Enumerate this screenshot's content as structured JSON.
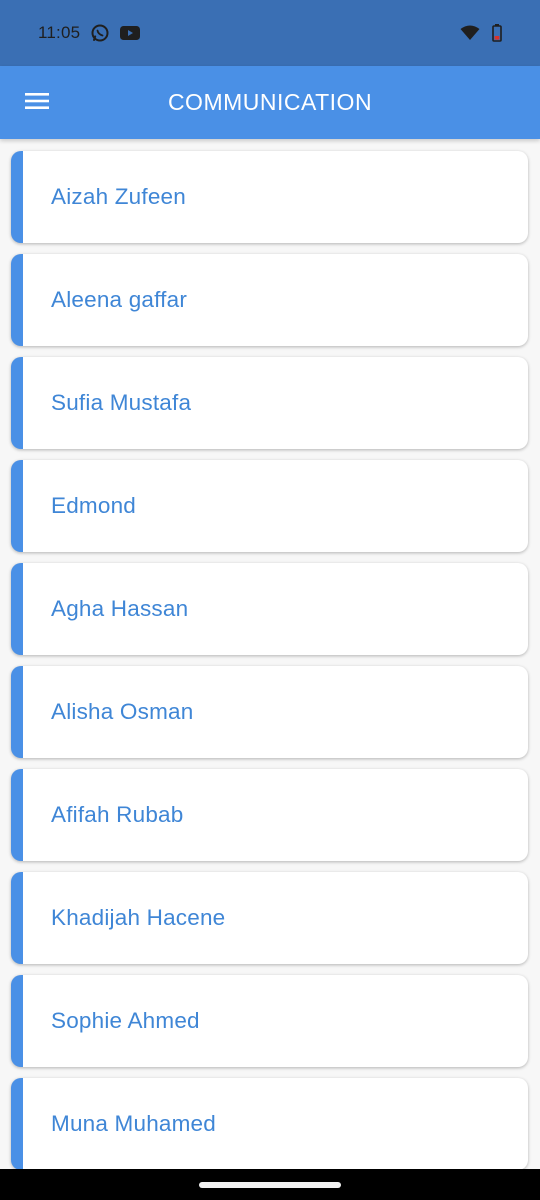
{
  "status_bar": {
    "time": "11:05",
    "icons_left": [
      "whatsapp-icon",
      "youtube-icon"
    ],
    "icons_right": [
      "wifi-icon",
      "battery-icon"
    ],
    "background": "#3a6fb4"
  },
  "app_bar": {
    "title": "COMMUNICATION",
    "menu_icon": "hamburger-menu-icon",
    "background": "#4a90e6"
  },
  "contacts": [
    {
      "name": "Aizah Zufeen"
    },
    {
      "name": "Aleena gaffar"
    },
    {
      "name": "Sufia Mustafa"
    },
    {
      "name": "Edmond"
    },
    {
      "name": "Agha Hassan"
    },
    {
      "name": "Alisha Osman"
    },
    {
      "name": "Afifah Rubab"
    },
    {
      "name": "Khadijah Hacene"
    },
    {
      "name": "Sophie Ahmed"
    },
    {
      "name": "Muna Muhamed"
    }
  ],
  "colors": {
    "accent": "#4a90e6",
    "name_text": "#3f86d6",
    "card_background": "#ffffff"
  }
}
